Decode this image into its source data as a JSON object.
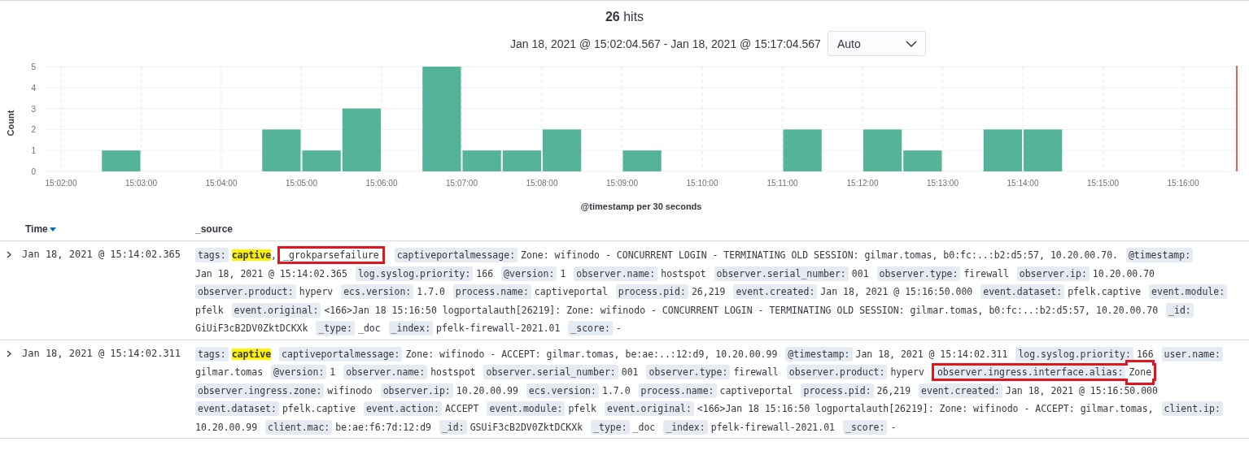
{
  "hits": {
    "count": "26",
    "label": "hits"
  },
  "time_range": "Jan 18, 2021 @ 15:02:04.567 - Jan 18, 2021 @ 15:17:04.567",
  "interval_select": {
    "value": "Auto"
  },
  "histogram": {
    "chart_data": {
      "type": "bar",
      "ylabel": "Count",
      "xlabel": "@timestamp per 30 seconds",
      "categories": [
        "15:02:00",
        null,
        "15:03:00",
        null,
        "15:04:00",
        null,
        "15:05:00",
        null,
        "15:06:00",
        null,
        "15:07:00",
        null,
        "15:08:00",
        null,
        "15:09:00",
        null,
        "15:10:00",
        null,
        "15:11:00",
        null,
        "15:12:00",
        null,
        "15:13:00",
        null,
        "15:14:00",
        null,
        "15:15:00",
        null,
        "15:16:00",
        null
      ],
      "series": [
        {
          "color": "#54b399",
          "values": [
            0,
            1,
            0,
            0,
            0,
            2,
            1,
            3,
            0,
            5,
            1,
            1,
            2,
            0,
            1,
            0,
            0,
            0,
            2,
            0,
            2,
            1,
            0,
            2,
            2,
            0,
            0,
            0,
            0,
            0
          ]
        }
      ],
      "grid": true,
      "ylim": [
        0,
        5
      ],
      "yticks": [
        0,
        1,
        2,
        3,
        4,
        5
      ]
    }
  },
  "table": {
    "columns": [
      {
        "label": "Time",
        "sorted": true
      },
      {
        "label": "_source",
        "sorted": false
      }
    ],
    "rows": [
      {
        "expanded": false,
        "time": "Jan 18, 2021 @ 15:14:02.365",
        "fields": [
          {
            "name": "tags:",
            "kind": "tags",
            "boxed": false,
            "separator": ",",
            "tags": [
              {
                "text": "captive",
                "highlighted": true,
                "boxed": false
              },
              {
                "text": "_grokparsefailure",
                "highlighted": false,
                "boxed": true
              }
            ]
          },
          {
            "name": "captiveportalmessage:",
            "kind": "text",
            "boxed": false,
            "value": "Zone: wifinodo - CONCURRENT LOGIN - TERMINATING OLD SESSION: gilmar.tomas, b0:fc:..:b2:d5:57, 10.20.00.70."
          },
          {
            "name": "@timestamp:",
            "kind": "text",
            "boxed": false,
            "value": "Jan 18, 2021 @ 15:14:02.365"
          },
          {
            "name": "log.syslog.priority:",
            "kind": "text",
            "boxed": false,
            "value": "166"
          },
          {
            "name": "@version:",
            "kind": "text",
            "boxed": false,
            "value": "1"
          },
          {
            "name": "observer.name:",
            "kind": "text",
            "boxed": false,
            "value": "hostspot"
          },
          {
            "name": "observer.serial_number:",
            "kind": "text",
            "boxed": false,
            "value": "001"
          },
          {
            "name": "observer.type:",
            "kind": "text",
            "boxed": false,
            "value": "firewall"
          },
          {
            "name": "observer.ip:",
            "kind": "text",
            "boxed": false,
            "value": "10.20.00.70"
          },
          {
            "name": "observer.product:",
            "kind": "text",
            "boxed": false,
            "value": "hyperv"
          },
          {
            "name": "ecs.version:",
            "kind": "text",
            "boxed": false,
            "value": "1.7.0"
          },
          {
            "name": "process.name:",
            "kind": "text",
            "boxed": false,
            "value": "captiveportal"
          },
          {
            "name": "process.pid:",
            "kind": "text",
            "boxed": false,
            "value": "26,219"
          },
          {
            "name": "event.created:",
            "kind": "text",
            "boxed": false,
            "value": "Jan 18, 2021 @ 15:16:50.000"
          },
          {
            "name": "event.dataset:",
            "kind": "text",
            "boxed": false,
            "value": "pfelk.captive"
          },
          {
            "name": "event.module:",
            "kind": "text",
            "boxed": false,
            "value": "pfelk"
          },
          {
            "name": "event.original:",
            "kind": "text",
            "boxed": false,
            "value": "<166>Jan 18 15:16:50 logportalauth[26219]: Zone: wifinodo - CONCURRENT LOGIN - TERMINATING OLD SESSION: gilmar.tomas, b0:fc:..:b2:d5:57, 10.20.00.70"
          },
          {
            "name": "_id:",
            "kind": "text",
            "boxed": false,
            "value": "GiUiF3cB2DV0ZktDCKXk"
          },
          {
            "name": "_type:",
            "kind": "text",
            "boxed": false,
            "value": "_doc"
          },
          {
            "name": "_index:",
            "kind": "text",
            "boxed": false,
            "value": "pfelk-firewall-2021.01"
          },
          {
            "name": "_score:",
            "kind": "text",
            "boxed": false,
            "value": "-"
          }
        ]
      },
      {
        "expanded": false,
        "time": "Jan 18, 2021 @ 15:14:02.311",
        "fields": [
          {
            "name": "tags:",
            "kind": "tags",
            "boxed": false,
            "tags": [
              {
                "text": "captive",
                "highlighted": true,
                "boxed": false
              }
            ]
          },
          {
            "name": "captiveportalmessage:",
            "kind": "text",
            "boxed": false,
            "value": "Zone: wifinodo - ACCEPT: gilmar.tomas, be:ae:..:12:d9, 10.20.00.99"
          },
          {
            "name": "@timestamp:",
            "kind": "text",
            "boxed": false,
            "value": "Jan 18, 2021 @ 15:14:02.311"
          },
          {
            "name": "log.syslog.priority:",
            "kind": "text",
            "boxed": false,
            "value": "166"
          },
          {
            "name": "user.name:",
            "kind": "text",
            "boxed": false,
            "value": "gilmar.tomas"
          },
          {
            "name": "@version:",
            "kind": "text",
            "boxed": false,
            "value": "1"
          },
          {
            "name": "observer.name:",
            "kind": "text",
            "boxed": false,
            "value": "hostspot"
          },
          {
            "name": "observer.serial_number:",
            "kind": "text",
            "boxed": false,
            "value": "001"
          },
          {
            "name": "observer.type:",
            "kind": "text",
            "boxed": false,
            "value": "firewall"
          },
          {
            "name": "observer.product:",
            "kind": "text",
            "boxed": false,
            "value": "hyperv"
          },
          {
            "name": "observer.ingress.interface.alias:",
            "kind": "text",
            "boxed": true,
            "value": "Zone"
          },
          {
            "name": "observer.ingress.zone:",
            "kind": "text",
            "boxed": false,
            "value": "wifinodo"
          },
          {
            "name": "observer.ip:",
            "kind": "text",
            "boxed": false,
            "value": "10.20.00.99"
          },
          {
            "name": "ecs.version:",
            "kind": "text",
            "boxed": false,
            "value": "1.7.0"
          },
          {
            "name": "process.name:",
            "kind": "text",
            "boxed": false,
            "value": "captiveportal"
          },
          {
            "name": "process.pid:",
            "kind": "text",
            "boxed": false,
            "value": "26,219"
          },
          {
            "name": "event.created:",
            "kind": "text",
            "boxed": false,
            "value": "Jan 18, 2021 @ 15:16:50.000"
          },
          {
            "name": "event.dataset:",
            "kind": "text",
            "boxed": false,
            "value": "pfelk.captive"
          },
          {
            "name": "event.action:",
            "kind": "text",
            "boxed": false,
            "value": "ACCEPT"
          },
          {
            "name": "event.module:",
            "kind": "text",
            "boxed": false,
            "value": "pfelk"
          },
          {
            "name": "event.original:",
            "kind": "text",
            "boxed": false,
            "value": "<166>Jan 18 15:16:50 logportalauth[26219]: Zone: wifinodo - ACCEPT: gilmar.tomas,"
          },
          {
            "name": "client.ip:",
            "kind": "text",
            "boxed": false,
            "value": "10.20.00.99"
          },
          {
            "name": "client.mac:",
            "kind": "text",
            "boxed": false,
            "value": "be:ae:f6:7d:12:d9"
          },
          {
            "name": "_id:",
            "kind": "text",
            "boxed": false,
            "value": "GSUiF3cB2DV0ZktDCKXk"
          },
          {
            "name": "_type:",
            "kind": "text",
            "boxed": false,
            "value": "_doc"
          },
          {
            "name": "_index:",
            "kind": "text",
            "boxed": false,
            "value": "pfelk-firewall-2021.01"
          },
          {
            "name": "_score:",
            "kind": "text",
            "boxed": false,
            "value": "-"
          }
        ]
      }
    ]
  }
}
